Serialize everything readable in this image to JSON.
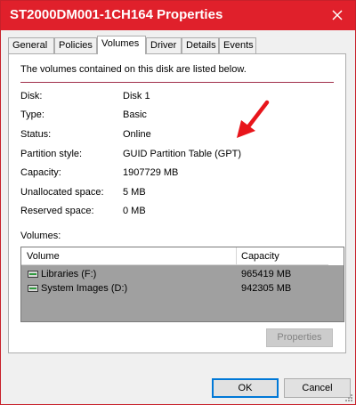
{
  "window": {
    "title": "ST2000DM001-1CH164 Properties",
    "close_icon": "close-icon",
    "accent_color": "#e0202b"
  },
  "tabs": [
    {
      "label": "General"
    },
    {
      "label": "Policies"
    },
    {
      "label": "Volumes",
      "active": true
    },
    {
      "label": "Driver"
    },
    {
      "label": "Details"
    },
    {
      "label": "Events"
    }
  ],
  "panel": {
    "intro": "The volumes contained on this disk are listed below.",
    "fields": [
      {
        "label": "Disk:",
        "value": "Disk 1"
      },
      {
        "label": "Type:",
        "value": "Basic"
      },
      {
        "label": "Status:",
        "value": "Online"
      },
      {
        "label": "Partition style:",
        "value": "GUID Partition Table (GPT)"
      },
      {
        "label": "Capacity:",
        "value": "1907729 MB"
      },
      {
        "label": "Unallocated space:",
        "value": "5 MB"
      },
      {
        "label": "Reserved space:",
        "value": "0 MB"
      }
    ],
    "annotation_icon": "red-arrow-icon",
    "volumes_label": "Volumes:",
    "volumes_table": {
      "headers": [
        "Volume",
        "Capacity"
      ],
      "rows": [
        {
          "volume": "Libraries (F:)",
          "capacity": "965419 MB",
          "icon": "drive-icon"
        },
        {
          "volume": "System Images (D:)",
          "capacity": "942305 MB",
          "icon": "drive-icon"
        }
      ]
    },
    "properties_button": "Properties"
  },
  "footer": {
    "ok": "OK",
    "cancel": "Cancel"
  }
}
